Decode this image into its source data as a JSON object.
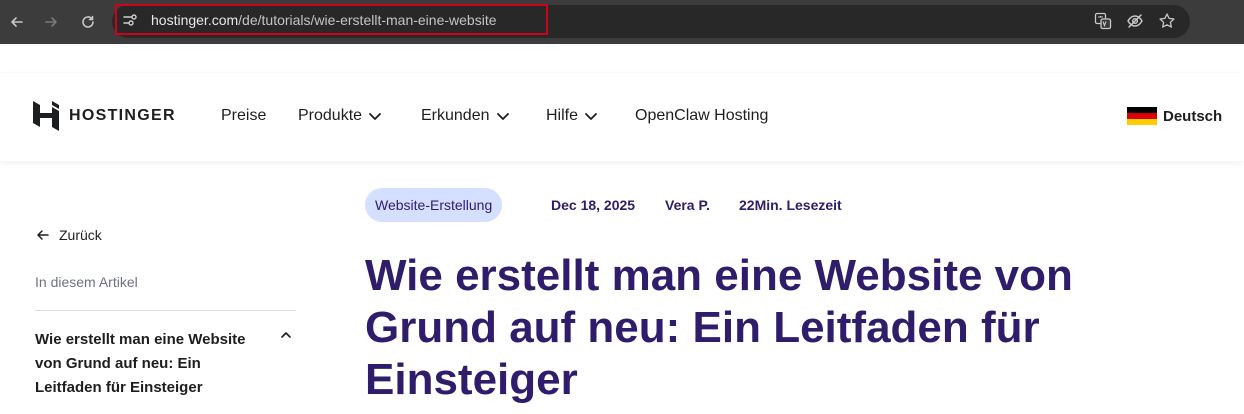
{
  "browser": {
    "url_host": "hostinger.com",
    "url_path": "/de/tutorials/wie-erstellt-man-eine-website"
  },
  "header": {
    "brand": "HOSTINGER",
    "nav": [
      {
        "label": "Preise"
      },
      {
        "label": "Produkte"
      },
      {
        "label": "Erkunden"
      },
      {
        "label": "Hilfe"
      },
      {
        "label": "OpenClaw Hosting"
      }
    ],
    "language": "Deutsch"
  },
  "sidebar": {
    "back_label": "Zurück",
    "toc_label": "In diesem Artikel",
    "toc_items": [
      {
        "label": "Wie erstellt man eine Website von Grund auf neu: Ein Leitfaden für Einsteiger"
      }
    ]
  },
  "article": {
    "category": "Website-Erstellung",
    "date": "Dec 18, 2025",
    "author": "Vera P.",
    "read_time": "22Min. Lesezeit",
    "title": "Wie erstellt man eine Website von Grund auf neu: Ein Leitfaden für Einsteiger"
  },
  "colors": {
    "accent": "#2f1c6a",
    "badge_bg": "#d5dfff",
    "highlight_border": "#d0021b"
  }
}
